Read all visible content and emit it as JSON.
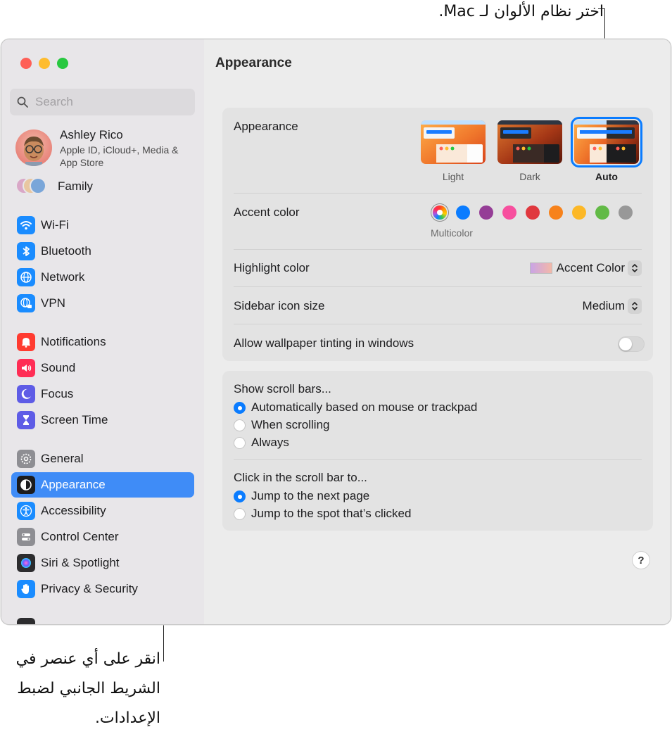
{
  "callouts": {
    "top": "اختر نظام الألوان لـ Mac.",
    "bottom": "انقر على أي عنصر في الشريط الجانبي لضبط الإعدادات."
  },
  "sidebar": {
    "search_placeholder": "Search",
    "account": {
      "name": "Ashley Rico",
      "subtitle": "Apple ID, iCloud+, Media & App Store"
    },
    "family_label": "Family",
    "items": [
      {
        "label": "Wi-Fi",
        "icon": "wifi-icon",
        "color": "#1a8cff"
      },
      {
        "label": "Bluetooth",
        "icon": "bluetooth-icon",
        "color": "#1a8cff"
      },
      {
        "label": "Network",
        "icon": "globe-icon",
        "color": "#1a8cff"
      },
      {
        "label": "VPN",
        "icon": "vpn-globe-icon",
        "color": "#1a8cff"
      },
      {
        "label": "Notifications",
        "icon": "bell-icon",
        "color": "#ff3b30"
      },
      {
        "label": "Sound",
        "icon": "speaker-icon",
        "color": "#ff2d55"
      },
      {
        "label": "Focus",
        "icon": "moon-icon",
        "color": "#5e5ce6"
      },
      {
        "label": "Screen Time",
        "icon": "hourglass-icon",
        "color": "#5e5ce6"
      },
      {
        "label": "General",
        "icon": "gear-icon",
        "color": "#8e8e93"
      },
      {
        "label": "Appearance",
        "icon": "appearance-icon",
        "color": "#1c1c1e"
      },
      {
        "label": "Accessibility",
        "icon": "accessibility-icon",
        "color": "#1a8cff"
      },
      {
        "label": "Control Center",
        "icon": "switches-icon",
        "color": "#8e8e93"
      },
      {
        "label": "Siri & Spotlight",
        "icon": "siri-icon",
        "color": "#2c2c2e"
      },
      {
        "label": "Privacy & Security",
        "icon": "hand-icon",
        "color": "#1a8cff"
      }
    ]
  },
  "content": {
    "title": "Appearance",
    "appearance": {
      "label": "Appearance",
      "options": [
        "Light",
        "Dark",
        "Auto"
      ],
      "selected": "Auto"
    },
    "accent": {
      "label": "Accent color",
      "colors": [
        "multicolor",
        "#0a7cff",
        "#953d96",
        "#f74f9e",
        "#e0383e",
        "#f7821b",
        "#fcb827",
        "#62ba46",
        "#989898"
      ],
      "selected_label": "Multicolor"
    },
    "highlight": {
      "label": "Highlight color",
      "value": "Accent Color"
    },
    "sidebar_icon_size": {
      "label": "Sidebar icon size",
      "value": "Medium"
    },
    "wallpaper_tinting": {
      "label": "Allow wallpaper tinting in windows",
      "enabled": false
    },
    "scroll_bars": {
      "label": "Show scroll bars...",
      "options": [
        "Automatically based on mouse or trackpad",
        "When scrolling",
        "Always"
      ],
      "selected": 0
    },
    "click_scroll": {
      "label": "Click in the scroll bar to...",
      "options": [
        "Jump to the next page",
        "Jump to the spot that’s clicked"
      ],
      "selected": 0
    },
    "help": "?"
  }
}
